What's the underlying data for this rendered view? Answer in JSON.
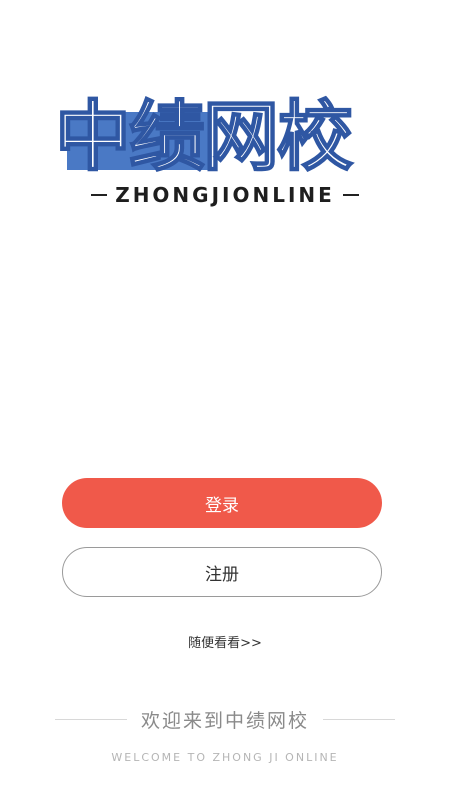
{
  "logo": {
    "chinese": "中绩网校",
    "english": "ZHONGJIONLINE"
  },
  "actions": {
    "login_label": "登录",
    "register_label": "注册",
    "browse_label": "随便看看>>"
  },
  "footer": {
    "welcome_cn": "欢迎来到中绩网校",
    "welcome_en": "WELCOME TO ZHONG JI ONLINE"
  },
  "colors": {
    "primary": "#f0594a",
    "logo_blue": "#4a79c5"
  }
}
